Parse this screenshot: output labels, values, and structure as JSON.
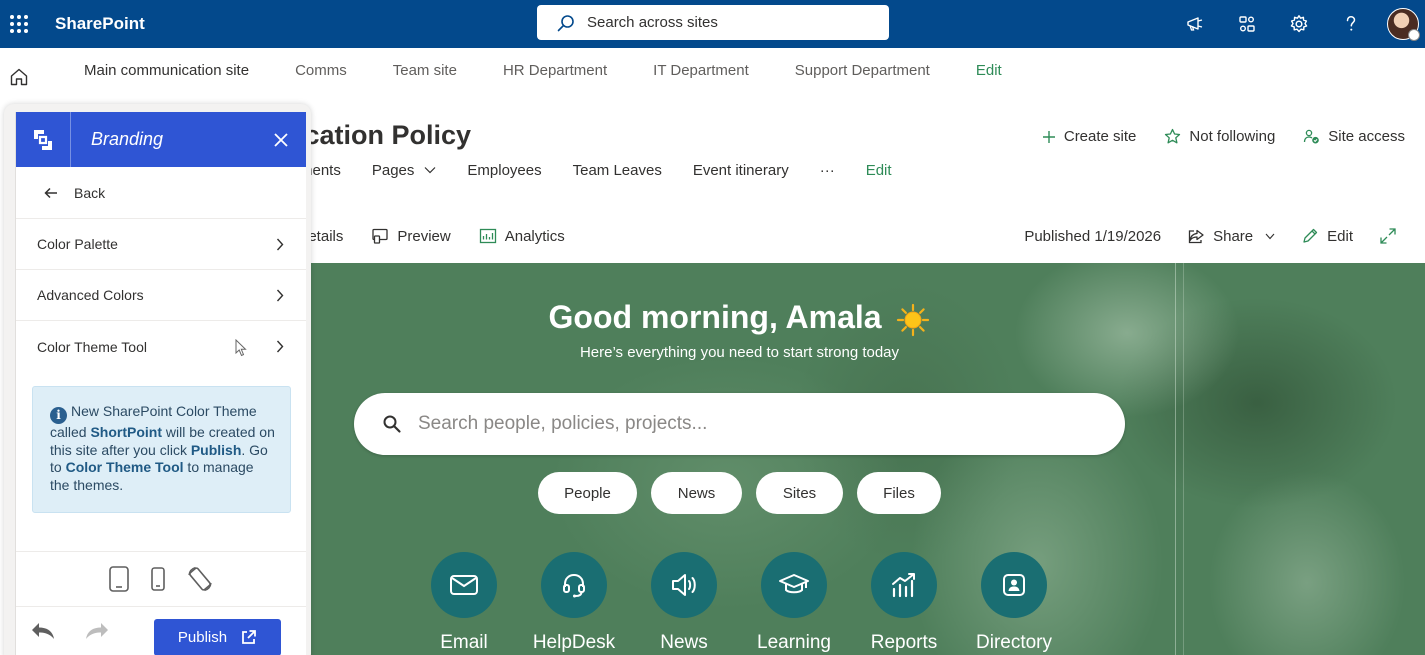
{
  "suite": {
    "app_name": "SharePoint",
    "search_placeholder": "Search across sites",
    "icons": [
      "waffle-icon",
      "megaphone-icon",
      "connections-icon",
      "gear-icon",
      "help-icon"
    ]
  },
  "hub_nav": {
    "items": [
      "Main communication site",
      "Comms",
      "Team site",
      "HR Department",
      "IT Department",
      "Support Department"
    ],
    "edit_label": "Edit"
  },
  "site": {
    "title_visible": "ication Policy",
    "nav": [
      "ments",
      "Pages",
      "Employees",
      "Team Leaves",
      "Event itinerary"
    ],
    "nav_more": "···",
    "nav_edit": "Edit",
    "actions": {
      "create_site": "Create site",
      "not_following": "Not following",
      "site_access": "Site access"
    }
  },
  "command_bar": {
    "details": "details",
    "preview": "Preview",
    "analytics": "Analytics",
    "published": "Published 1/19/2026",
    "share": "Share",
    "edit": "Edit"
  },
  "hero": {
    "greeting": "Good morning, Amala",
    "subtitle": "Here’s everything you need to start strong today",
    "search_placeholder": "Search people, policies, projects...",
    "pills": [
      "People",
      "News",
      "Sites",
      "Files"
    ],
    "tiles": [
      {
        "label": "Email",
        "icon": "mail-icon"
      },
      {
        "label": "HelpDesk",
        "icon": "headset-icon"
      },
      {
        "label": "News",
        "icon": "speaker-icon"
      },
      {
        "label": "Learning",
        "icon": "graduation-cap-icon"
      },
      {
        "label": "Reports",
        "icon": "chart-up-icon"
      },
      {
        "label": "Directory",
        "icon": "contact-card-icon"
      }
    ],
    "background_color": "#4f7f5b",
    "tile_color": "#1a6e72"
  },
  "branding_panel": {
    "title": "Branding",
    "back_label": "Back",
    "menu": [
      "Color Palette",
      "Advanced Colors",
      "Color Theme Tool"
    ],
    "info": {
      "t1": "New SharePoint Color Theme called ",
      "b1": "ShortPoint",
      "t2": " will be created on this site after you click ",
      "b2": "Publish",
      "t3": ". Go to ",
      "b3": "Color Theme Tool",
      "t4": " to manage the themes."
    },
    "publish_label": "Publish",
    "accent_color": "#2f55d4"
  }
}
